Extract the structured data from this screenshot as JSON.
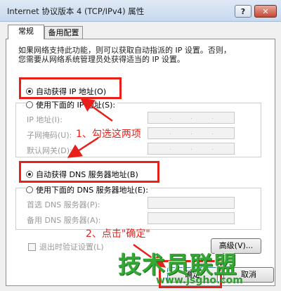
{
  "window": {
    "title": "Internet 协议版本 4 (TCP/IPv4) 属性",
    "help_label": "?",
    "close_label": "✕"
  },
  "tabs": [
    {
      "label": "常规",
      "active": true
    },
    {
      "label": "备用配置",
      "active": false
    }
  ],
  "description": {
    "line1": "如果网络支持此功能，则可以获取自动指派的 IP 设置。否则，",
    "line2": "您需要从网络系统管理员处获得适当的 IP 设置。"
  },
  "ip_section": {
    "auto_label": "自动获得 IP 地址(O)",
    "auto_checked": true,
    "manual_label": "使用下面的 IP 地址(S):",
    "fields": [
      {
        "label": "IP 地址(I):",
        "dots": [
          ".",
          " .",
          " ."
        ]
      },
      {
        "label": "子网掩码(U):",
        "dots": [
          ".",
          " .",
          " ."
        ]
      },
      {
        "label": "默认网关(D):",
        "dots": [
          ".",
          " .",
          " ."
        ]
      }
    ]
  },
  "dns_section": {
    "auto_label": "自动获得 DNS 服务器地址(B)",
    "auto_checked": true,
    "manual_label": "使用下面的 DNS 服务器地址(E):",
    "fields": [
      {
        "label": "首选 DNS 服务器(P):"
      },
      {
        "label": "备用 DNS 服务器(A):"
      }
    ]
  },
  "exit_validate": {
    "label": "退出时验证设置(L)",
    "checked": false
  },
  "buttons": {
    "advanced": "高级(V)...",
    "ok": "确定",
    "cancel": "取消"
  },
  "annotations": {
    "step1": "1、勾选这两项",
    "step2": "2、点击\"确定\""
  },
  "watermark": {
    "main": "技术员联盟",
    "url": "www.jsgho.com"
  },
  "colors": {
    "highlight": "#e8201a",
    "watermark": "#33a832"
  }
}
